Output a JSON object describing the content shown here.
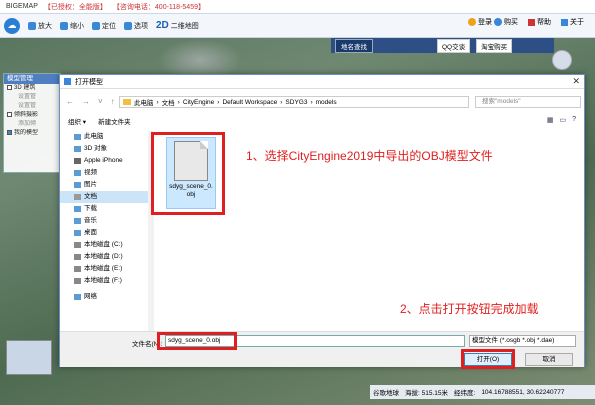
{
  "app": {
    "title": "BIGEMAP",
    "license": "【已授权：全能版】",
    "hotline": "【咨询电话：400-118-5459】"
  },
  "toolbar": {
    "zoom_in": "放大",
    "zoom_out": "缩小",
    "locate": "定位",
    "options": "选项",
    "mode_2d": "2D",
    "mode_2d_label": "二维地图",
    "login": "登录",
    "buy": "购买",
    "help": "帮助",
    "about": "关于"
  },
  "map_search": {
    "title": "地名查找",
    "qq": "QQ交谈",
    "taobao": "淘宝购买"
  },
  "side_panel": {
    "title": "模型管理",
    "items": [
      {
        "label": "3D 建筑"
      },
      {
        "label": "设置管"
      },
      {
        "label": "设置管"
      },
      {
        "label": "倾斜摄影"
      },
      {
        "label": "添加倾"
      },
      {
        "label": "我的模型"
      }
    ]
  },
  "dialog": {
    "title": "打开模型",
    "address": [
      "此电脑",
      "文档",
      "CityEngine",
      "Default Workspace",
      "SDYG3",
      "models"
    ],
    "search_placeholder": "搜索\"models\"",
    "organize": "组织 ▾",
    "new_folder": "新建文件夹",
    "tree": [
      {
        "label": "此电脑"
      },
      {
        "label": "3D 对象"
      },
      {
        "label": "Apple iPhone"
      },
      {
        "label": "视频"
      },
      {
        "label": "图片"
      },
      {
        "label": "文档"
      },
      {
        "label": "下载"
      },
      {
        "label": "音乐"
      },
      {
        "label": "桌面"
      },
      {
        "label": "本地磁盘 (C:)"
      },
      {
        "label": "本地磁盘 (D:)"
      },
      {
        "label": "本地磁盘 (E:)"
      },
      {
        "label": "本地磁盘 (F:)"
      },
      {
        "label": "网络"
      }
    ],
    "file": {
      "name": "sdyg_scene_0.obj"
    },
    "annotation_1": "1、选择CityEngine2019中导出的OBJ模型文件",
    "annotation_2": "2、点击打开按钮完成加载",
    "filename_label": "文件名(N):",
    "filename_value": "sdyg_scene_0.obj",
    "filetype": "模型文件 (*.osgb *.obj *.dae)",
    "open_button": "打开(O)",
    "cancel_button": "取消"
  },
  "status": {
    "source": "谷歌地球",
    "altitude": "海拔: 515.15米",
    "coords_label": "经纬度:",
    "coords": "104.16788551, 30.62240777"
  }
}
